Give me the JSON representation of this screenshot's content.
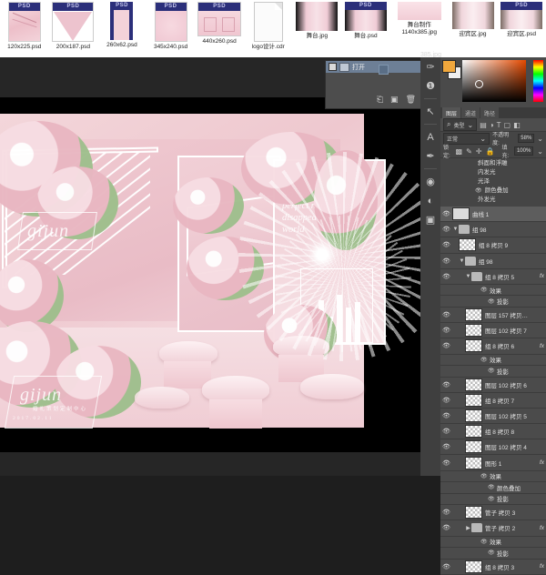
{
  "filestrip": {
    "files": [
      {
        "name": "120x225.psd",
        "badge": "PSD"
      },
      {
        "name": "200x187.psd",
        "badge": "PSD"
      },
      {
        "name": "260x62.psd",
        "badge": "PSD"
      },
      {
        "name": "345x240.psd",
        "badge": "PSD"
      },
      {
        "name": "440x260.psd",
        "badge": "PSD"
      },
      {
        "name": "logo设计.cdr",
        "badge": ""
      },
      {
        "name": "舞台.jpg",
        "badge": ""
      },
      {
        "name": "舞台.psd",
        "badge": "PSD"
      },
      {
        "name": "舞台制作1140x385.jpg",
        "badge": ""
      },
      {
        "name": "迎宾区.jpg",
        "badge": ""
      },
      {
        "name": "迎宾区.psd",
        "badge": "PSD"
      }
    ]
  },
  "canvas": {
    "script_text": "No matter the ending is perfect not, you cannot disappear from my world",
    "watermark_top": "gijun",
    "watermark_bottom": "gijun",
    "watermark_sub": "婚礼策划定制中心",
    "watermark_date": "2017.02.11"
  },
  "open_dialog": {
    "title": "打开",
    "icons": {
      "new": "new-doc-icon",
      "camera": "camera-icon",
      "delete": "trash-icon"
    }
  },
  "toolbar": {
    "tools": [
      {
        "name": "history-brush-tool",
        "glyph": "✑"
      },
      {
        "name": "info-tool",
        "glyph": "❶"
      },
      {
        "name": "path-select-tool",
        "glyph": "↖"
      },
      {
        "name": "type-tool",
        "glyph": "A"
      },
      {
        "name": "pen-tool",
        "glyph": "✒"
      },
      {
        "name": "sponge-tool",
        "glyph": "◉"
      },
      {
        "name": "dodge-tool",
        "glyph": "◐"
      },
      {
        "name": "pattern-stamp-tool",
        "glyph": "▣"
      }
    ]
  },
  "color_panel": {
    "foreground": "#f0a73c",
    "background": "#efefef"
  },
  "layers_panel": {
    "tabs": [
      {
        "label": "图层",
        "active": true
      },
      {
        "label": "通道",
        "active": false
      },
      {
        "label": "路径",
        "active": false
      }
    ],
    "filter": {
      "kind_label": "类型"
    },
    "blend_mode": "正常",
    "opacity_label": "不透明度:",
    "opacity_value": "58%",
    "lock_label": "锁定:",
    "fill_label": "填充:",
    "fill_value": "100%",
    "top_effects": [
      "斜面和浮雕",
      "内发光",
      "光泽",
      "颜色叠加",
      "外发光"
    ],
    "rows": [
      {
        "type": "layer",
        "thumb": "curve",
        "name": "曲线 1",
        "indent": 0,
        "selected": true,
        "fx": false
      },
      {
        "type": "group",
        "name": "组 98",
        "indent": 0,
        "expanded": true,
        "fx": false
      },
      {
        "type": "layer",
        "name": "组 8 拷贝 9",
        "indent": 1,
        "fx": false
      },
      {
        "type": "group",
        "name": "组 98",
        "indent": 1,
        "expanded": true,
        "fx": false
      },
      {
        "type": "group",
        "name": "组 8 拷贝 5",
        "indent": 2,
        "expanded": true,
        "fx": true
      },
      {
        "type": "effect-head",
        "name": "效果",
        "indent": 3
      },
      {
        "type": "effect-item",
        "name": "投影",
        "indent": 4
      },
      {
        "type": "layer",
        "name": "图层 157 拷贝…",
        "indent": 2,
        "fx": false
      },
      {
        "type": "layer",
        "name": "图层 102 拷贝 7",
        "indent": 2,
        "fx": false
      },
      {
        "type": "layer",
        "name": "组 8 拷贝 6",
        "indent": 2,
        "fx": true
      },
      {
        "type": "effect-head",
        "name": "效果",
        "indent": 3
      },
      {
        "type": "effect-item",
        "name": "投影",
        "indent": 4
      },
      {
        "type": "layer",
        "name": "图层 102 拷贝 6",
        "indent": 2,
        "fx": false
      },
      {
        "type": "layer",
        "name": "组 8 拷贝 7",
        "indent": 2,
        "fx": false
      },
      {
        "type": "layer",
        "name": "图层 102 拷贝 5",
        "indent": 2,
        "fx": false
      },
      {
        "type": "layer",
        "name": "组 8 拷贝 8",
        "indent": 2,
        "fx": false
      },
      {
        "type": "layer",
        "name": "图层 102 拷贝 4",
        "indent": 2,
        "fx": false
      },
      {
        "type": "layer",
        "name": "图形 1",
        "indent": 2,
        "fx": true,
        "shape": true
      },
      {
        "type": "effect-head",
        "name": "效果",
        "indent": 3
      },
      {
        "type": "effect-item",
        "name": "颜色叠加",
        "indent": 4
      },
      {
        "type": "effect-item",
        "name": "投影",
        "indent": 4
      },
      {
        "type": "layer",
        "name": "管子 拷贝 3",
        "indent": 2,
        "fx": false
      },
      {
        "type": "group",
        "name": "管子 拷贝 2",
        "indent": 2,
        "expanded": false,
        "fx": true
      },
      {
        "type": "effect-head",
        "name": "效果",
        "indent": 3
      },
      {
        "type": "effect-item",
        "name": "投影",
        "indent": 4
      },
      {
        "type": "layer",
        "name": "组 8 拷贝 3",
        "indent": 2,
        "fx": true
      }
    ]
  }
}
